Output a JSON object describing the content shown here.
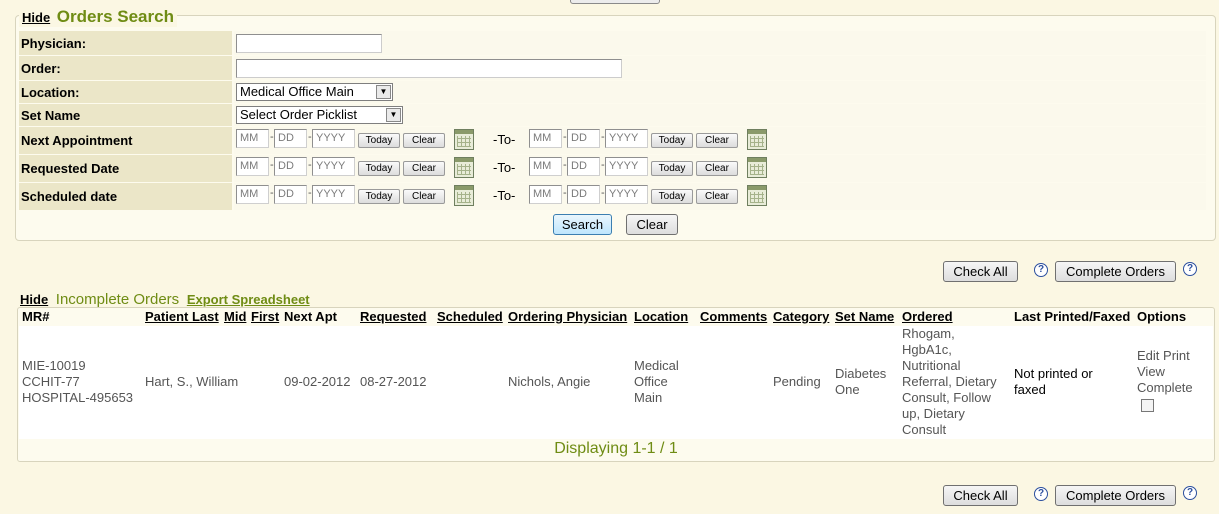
{
  "search": {
    "hide_label": "Hide",
    "title": "Orders Search",
    "labels": {
      "physician": "Physician:",
      "order": "Order:",
      "location": "Location:",
      "set_name": "Set Name",
      "next_appointment": "Next Appointment",
      "requested_date": "Requested Date",
      "scheduled_date": "Scheduled date"
    },
    "physician_value": "",
    "order_value": "",
    "location_selected": "Medical Office Main",
    "set_name_selected": "Select Order Picklist",
    "date_placeholders": {
      "month": "MM",
      "day": "DD",
      "year": "YYYY"
    },
    "today_label": "Today",
    "clear_label": "Clear",
    "to_label": "-To-",
    "separator": "-",
    "search_button": "Search",
    "clear_button": "Clear"
  },
  "actions": {
    "check_all": "Check All",
    "complete_orders": "Complete Orders",
    "help_glyph": "?"
  },
  "orders": {
    "hide_label": "Hide",
    "title": "Incomplete Orders",
    "export_label": "Export Spreadsheet",
    "columns": {
      "mr": "MR#",
      "patient_last": "Patient Last",
      "mid": "Mid",
      "first": "First",
      "next_apt": "Next Apt",
      "requested": "Requested",
      "scheduled": "Scheduled",
      "ordering_physician": "Ordering Physician",
      "location": "Location",
      "comments": "Comments",
      "category": "Category",
      "set_name": "Set Name",
      "ordered": "Ordered",
      "last_printed": "Last Printed/Faxed",
      "options": "Options"
    },
    "rows": [
      {
        "mr": [
          "MIE-10019",
          "CCHIT-77",
          "HOSPITAL-495653"
        ],
        "patient": "Hart, S., William",
        "next_apt": "09-02-2012",
        "requested": "08-27-2012",
        "scheduled": "",
        "physician": "Nichols, Angie",
        "location": [
          "Medical",
          "Office",
          "Main"
        ],
        "comments": "",
        "category": "Pending",
        "set_name": [
          "Diabetes",
          "One"
        ],
        "ordered": [
          "Rhogam,",
          "HgbA1c,",
          "Nutritional",
          "Referral, Dietary",
          "Consult, Follow",
          "up, Dietary",
          "Consult"
        ],
        "last_printed": [
          "Not printed or",
          "faxed"
        ],
        "options": {
          "edit": "Edit",
          "print": "Print",
          "view": "View",
          "complete": "Complete"
        }
      }
    ],
    "pager_text": "Displaying 1-1 / 1"
  }
}
